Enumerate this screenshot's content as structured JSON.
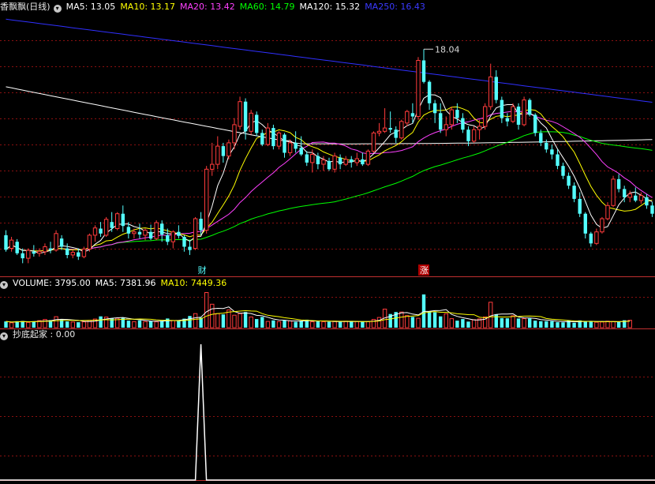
{
  "header_main": {
    "title": "香飘飘(日线)",
    "ma5": "MA5: 13.05",
    "ma10": "MA10: 13.17",
    "ma20": "MA20: 13.42",
    "ma60": "MA60: 14.79",
    "ma120": "MA120: 15.32",
    "ma250": "MA250: 16.43"
  },
  "header_volume": {
    "label": "VOLUME: 3795.00",
    "ma5": "MA5: 7381.96",
    "ma10": "MA10: 7449.36"
  },
  "header_indicator": {
    "label": "抄底起家 : 0.00"
  },
  "markers": {
    "cai": "财",
    "zhang": "涨",
    "peak": "18.04"
  },
  "colors": {
    "up": "#ff3b3b",
    "down": "#54ffff",
    "ma5": "#ffffff",
    "ma10": "#ffff00",
    "ma20": "#ff40ff",
    "ma60": "#00ff00",
    "ma120": "#ffffff",
    "ma250": "#3030ff",
    "grid": "#8a1010"
  },
  "chart_data": [
    {
      "type": "candlestick",
      "title": "香飘飘(日线)",
      "ylim": [
        11.2,
        19.1
      ],
      "peak_label": 18.04,
      "candles": [
        [
          12.4,
          12.55,
          11.9,
          11.96
        ],
        [
          12.0,
          12.35,
          11.9,
          12.25
        ],
        [
          12.2,
          12.28,
          11.8,
          11.85
        ],
        [
          11.85,
          12.0,
          11.55,
          11.7
        ],
        [
          11.7,
          12.0,
          11.55,
          11.94
        ],
        [
          11.9,
          12.1,
          11.75,
          11.84
        ],
        [
          11.85,
          12.0,
          11.75,
          11.91
        ],
        [
          11.9,
          12.15,
          11.8,
          12.05
        ],
        [
          12.0,
          12.2,
          11.85,
          11.95
        ],
        [
          11.95,
          12.55,
          11.9,
          12.45
        ],
        [
          12.3,
          12.4,
          11.95,
          12.05
        ],
        [
          12.0,
          12.15,
          11.7,
          11.8
        ],
        [
          11.8,
          11.95,
          11.7,
          11.88
        ],
        [
          11.88,
          12.0,
          11.65,
          11.75
        ],
        [
          11.75,
          12.05,
          11.7,
          11.98
        ],
        [
          11.98,
          12.45,
          11.9,
          12.4
        ],
        [
          12.4,
          12.7,
          12.2,
          12.62
        ],
        [
          12.6,
          12.8,
          12.35,
          12.45
        ],
        [
          12.4,
          12.95,
          12.35,
          12.88
        ],
        [
          12.8,
          13.1,
          12.5,
          12.62
        ],
        [
          12.6,
          13.1,
          12.55,
          13.05
        ],
        [
          13.05,
          13.3,
          12.5,
          12.68
        ],
        [
          12.65,
          12.8,
          12.3,
          12.45
        ],
        [
          12.45,
          12.6,
          12.3,
          12.5
        ],
        [
          12.5,
          12.75,
          12.3,
          12.42
        ],
        [
          12.4,
          12.6,
          12.25,
          12.55
        ],
        [
          12.5,
          12.72,
          12.25,
          12.3
        ],
        [
          12.3,
          12.85,
          12.25,
          12.78
        ],
        [
          12.75,
          12.85,
          12.2,
          12.42
        ],
        [
          12.4,
          12.6,
          12.1,
          12.2
        ],
        [
          12.2,
          12.55,
          12.0,
          12.5
        ],
        [
          12.5,
          12.7,
          12.3,
          12.38
        ],
        [
          12.35,
          12.4,
          11.9,
          12.05
        ],
        [
          12.05,
          12.25,
          11.8,
          11.95
        ],
        [
          12.0,
          12.95,
          11.95,
          12.9
        ],
        [
          12.9,
          13.1,
          12.4,
          12.55
        ],
        [
          12.55,
          14.5,
          12.45,
          14.4
        ],
        [
          14.4,
          15.2,
          14.2,
          14.55
        ],
        [
          14.55,
          15.4,
          14.4,
          15.1
        ],
        [
          15.1,
          15.2,
          14.6,
          14.8
        ],
        [
          14.8,
          15.3,
          14.7,
          15.2
        ],
        [
          15.2,
          15.95,
          15.0,
          15.75
        ],
        [
          15.7,
          16.6,
          15.6,
          16.45
        ],
        [
          16.45,
          16.55,
          15.3,
          15.55
        ],
        [
          15.55,
          16.2,
          15.45,
          16.1
        ],
        [
          16.05,
          16.15,
          15.4,
          15.5
        ],
        [
          15.5,
          15.6,
          15.1,
          15.15
        ],
        [
          15.15,
          15.8,
          15.1,
          15.65
        ],
        [
          15.65,
          15.75,
          15.0,
          15.1
        ],
        [
          15.1,
          15.55,
          15.0,
          15.5
        ],
        [
          15.45,
          15.5,
          14.75,
          14.9
        ],
        [
          14.9,
          15.3,
          14.8,
          15.2
        ],
        [
          15.2,
          15.55,
          14.9,
          15.02
        ],
        [
          15.05,
          15.4,
          14.8,
          14.85
        ],
        [
          14.85,
          14.95,
          14.5,
          14.6
        ],
        [
          14.6,
          15.0,
          14.3,
          14.85
        ],
        [
          14.8,
          14.9,
          14.4,
          14.55
        ],
        [
          14.55,
          14.8,
          14.35,
          14.68
        ],
        [
          14.65,
          14.75,
          14.35,
          14.4
        ],
        [
          14.4,
          14.9,
          14.3,
          14.8
        ],
        [
          14.75,
          14.85,
          14.4,
          14.55
        ],
        [
          14.55,
          14.8,
          14.5,
          14.7
        ],
        [
          14.7,
          14.8,
          14.45,
          14.62
        ],
        [
          14.6,
          14.9,
          14.5,
          14.72
        ],
        [
          14.7,
          14.9,
          14.5,
          14.55
        ],
        [
          14.55,
          15.0,
          14.5,
          14.95
        ],
        [
          14.95,
          15.55,
          14.9,
          15.5
        ],
        [
          15.5,
          15.8,
          15.4,
          15.55
        ],
        [
          15.55,
          16.25,
          15.5,
          15.65
        ],
        [
          15.65,
          16.15,
          15.5,
          15.6
        ],
        [
          15.6,
          15.7,
          15.2,
          15.35
        ],
        [
          15.35,
          15.9,
          15.3,
          15.85
        ],
        [
          15.8,
          16.2,
          15.7,
          16.15
        ],
        [
          16.1,
          16.4,
          15.8,
          16.0
        ],
        [
          16.0,
          17.8,
          15.9,
          17.7
        ],
        [
          17.7,
          18.04,
          17.0,
          17.05
        ],
        [
          17.05,
          17.1,
          16.2,
          16.4
        ],
        [
          16.4,
          16.5,
          15.8,
          16.1
        ],
        [
          16.1,
          16.4,
          15.5,
          15.6
        ],
        [
          15.6,
          16.0,
          15.4,
          15.75
        ],
        [
          15.75,
          16.3,
          15.6,
          16.2
        ],
        [
          16.2,
          16.4,
          15.8,
          15.95
        ],
        [
          15.95,
          16.1,
          15.5,
          15.6
        ],
        [
          15.6,
          15.7,
          15.1,
          15.25
        ],
        [
          15.25,
          15.7,
          15.2,
          15.6
        ],
        [
          15.6,
          15.9,
          15.3,
          15.7
        ],
        [
          15.7,
          16.4,
          15.6,
          16.3
        ],
        [
          16.3,
          17.6,
          16.2,
          17.2
        ],
        [
          17.2,
          17.4,
          16.4,
          16.5
        ],
        [
          16.5,
          16.6,
          15.8,
          15.95
        ],
        [
          15.95,
          16.1,
          15.7,
          15.85
        ],
        [
          15.85,
          16.4,
          15.8,
          16.3
        ],
        [
          16.3,
          16.4,
          15.6,
          15.75
        ],
        [
          15.75,
          16.6,
          15.7,
          16.5
        ],
        [
          16.5,
          16.55,
          16.0,
          16.05
        ],
        [
          16.05,
          16.1,
          15.4,
          15.5
        ],
        [
          15.5,
          15.6,
          15.1,
          15.2
        ],
        [
          15.2,
          15.3,
          14.9,
          15.0
        ],
        [
          15.0,
          15.15,
          14.7,
          14.85
        ],
        [
          14.85,
          15.0,
          14.4,
          14.5
        ],
        [
          14.5,
          14.6,
          14.1,
          14.2
        ],
        [
          14.2,
          14.3,
          13.8,
          13.9
        ],
        [
          13.9,
          14.0,
          13.4,
          13.5
        ],
        [
          13.5,
          13.7,
          12.95,
          13.05
        ],
        [
          13.05,
          13.1,
          12.3,
          12.45
        ],
        [
          12.45,
          12.5,
          12.05,
          12.15
        ],
        [
          12.15,
          12.6,
          12.1,
          12.5
        ],
        [
          12.5,
          12.95,
          12.45,
          12.9
        ],
        [
          12.9,
          13.4,
          12.85,
          13.3
        ],
        [
          13.3,
          14.2,
          13.25,
          14.1
        ],
        [
          14.1,
          14.25,
          13.7,
          13.8
        ],
        [
          13.8,
          13.9,
          13.4,
          13.55
        ],
        [
          13.55,
          13.75,
          13.4,
          13.65
        ],
        [
          13.6,
          13.85,
          13.4,
          13.45
        ],
        [
          13.45,
          13.7,
          13.35,
          13.6
        ],
        [
          13.55,
          13.65,
          13.2,
          13.3
        ],
        [
          13.3,
          13.4,
          12.95,
          13.05
        ]
      ],
      "ma250_range": [
        18.95,
        16.43
      ],
      "ma120_range": [
        16.9,
        15.32
      ]
    },
    {
      "type": "bar",
      "title": "VOLUME",
      "ylim": [
        0,
        19000
      ],
      "values": [
        3200,
        2500,
        3300,
        3400,
        2700,
        3300,
        3600,
        4200,
        3900,
        5600,
        4200,
        3200,
        2900,
        2800,
        3000,
        3700,
        4400,
        5800,
        5400,
        4800,
        4800,
        5200,
        3600,
        3100,
        3700,
        3100,
        3400,
        3000,
        3500,
        4700,
        3600,
        3800,
        4600,
        6000,
        7200,
        5100,
        18000,
        12000,
        7200,
        6800,
        9100,
        6400,
        7200,
        8000,
        5500,
        4400,
        5500,
        3200,
        3700,
        3100,
        3800,
        3500,
        3000,
        3600,
        4100,
        3000,
        3400,
        3000,
        3000,
        3300,
        3000,
        3300,
        3200,
        3100,
        3000,
        3100,
        4200,
        5200,
        9500,
        7000,
        8000,
        8000,
        6200,
        5500,
        4800,
        17000,
        8500,
        7900,
        5800,
        7100,
        4600,
        3600,
        4400,
        3100,
        4100,
        4500,
        5500,
        13000,
        6800,
        4900,
        4800,
        6100,
        4700,
        4600,
        4700,
        3600,
        3300,
        3300,
        3300,
        2800,
        2700,
        3600,
        2500,
        3700,
        3400,
        3200,
        2800,
        2900,
        3300,
        3100,
        3000,
        3800,
        3795
      ]
    },
    {
      "type": "line",
      "title": "抄底起家",
      "ylim": [
        0,
        1
      ],
      "spike_index": 35,
      "value": 0.0
    }
  ]
}
